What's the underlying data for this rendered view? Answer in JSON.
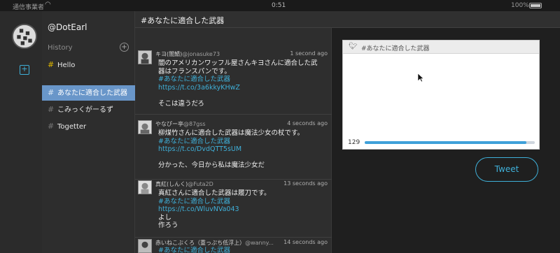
{
  "status_bar": {
    "carrier": "通信事業者",
    "time": "0:51",
    "battery": "100%"
  },
  "rail": {
    "compose_icon": "compose-icon"
  },
  "sidebar": {
    "username": "@DotEarl",
    "history_label": "History",
    "add_icon": "plus-circle-icon",
    "items": [
      {
        "label": "Hello",
        "hash": "#"
      },
      {
        "label": "あなたに適合した武器",
        "hash": "#"
      },
      {
        "label": "こみっくがーるず",
        "hash": "#"
      },
      {
        "label": "Togetter",
        "hash": "#"
      }
    ]
  },
  "header": {
    "title": "#あなたに適合した武器"
  },
  "tweets": [
    {
      "name": "キヨ(闇鯖)",
      "screen": "@jonasuke73",
      "time": "1 second ago",
      "lines": [
        "闇のアメリカンワッフル屋さんキヨさんに適合した武",
        "器はフランスパンです。"
      ],
      "tag": "#あなたに適合した武器",
      "link": "https://t.co/3a6kkyKHwZ",
      "extra": [
        "そこは違うだろ"
      ]
    },
    {
      "name": "やなぴー亭",
      "screen": "@87gss",
      "time": "4 seconds ago",
      "lines": [
        "柳煤竹さんに適合した武器は魔法少女の杖です。"
      ],
      "tag": "#あなたに適合した武器",
      "link": "https://t.co/DvdQTT5sUM",
      "extra": [
        "分かった、今日から私は魔法少女だ"
      ]
    },
    {
      "name": "真紅(しんく)",
      "screen": "@Futa2D",
      "time": "13 seconds ago",
      "lines": [
        "真紅さんに適合した武器は履刀です。"
      ],
      "tag": "#あなたに適合した武器",
      "link": "https://t.co/WluvNVa043",
      "extra": [
        "よし",
        "作ろう"
      ]
    },
    {
      "name": "赤いねこぶくろ（重っぷち低浮上）",
      "screen": "@wanny...",
      "time": "14 seconds ago",
      "lines": [],
      "tag": "#あなたに適合した武器",
      "link": "",
      "extra": []
    }
  ],
  "composer": {
    "bird_icon": "twitter-bird-icon",
    "card_tag": "#あなたに適合した武器",
    "remaining": "129",
    "progress_fraction": 0.95,
    "tweet_button": "Tweet"
  },
  "colors": {
    "accent": "#3fb0d9",
    "active_row": "#6996c9",
    "hello_hash": "#e0b800"
  }
}
